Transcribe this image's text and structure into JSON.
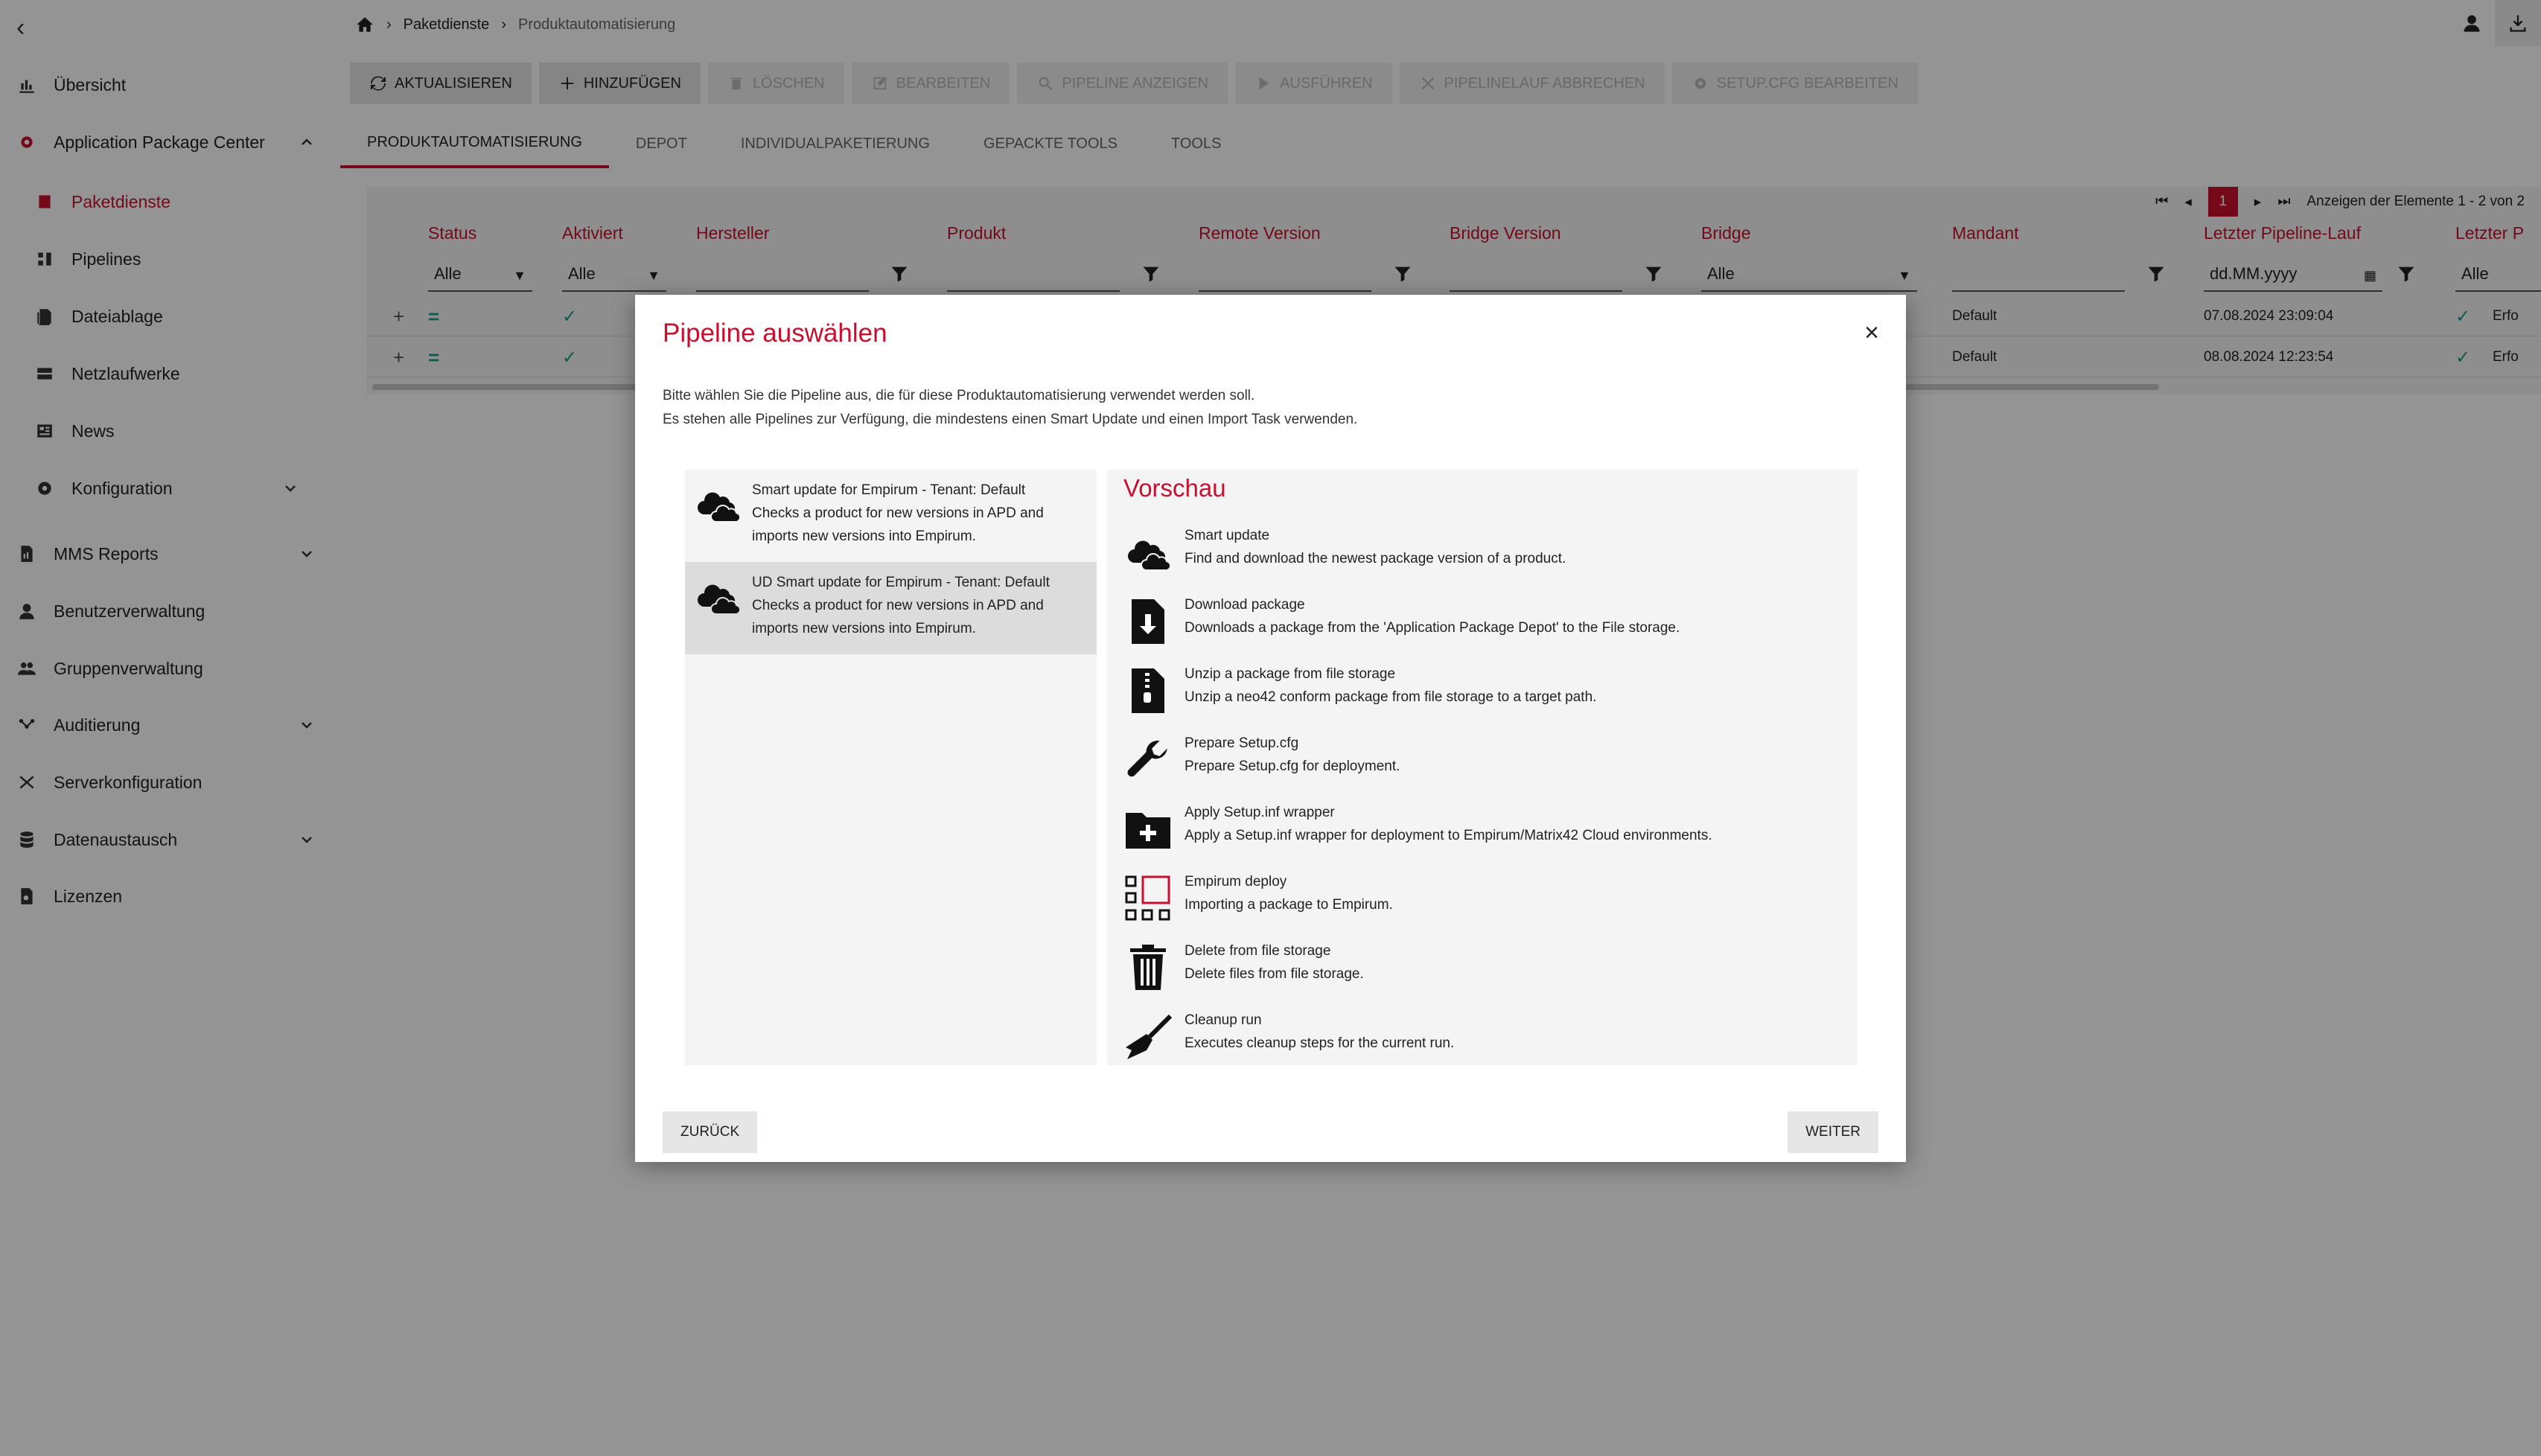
{
  "sidebar": {
    "items": [
      {
        "label": "Übersicht",
        "icon": "chart-icon"
      },
      {
        "label": "Application Package Center",
        "icon": "gear-icon"
      },
      {
        "label": "Paketdienste",
        "icon": "package-icon"
      },
      {
        "label": "Pipelines",
        "icon": "pipeline-icon"
      },
      {
        "label": "Dateiablage",
        "icon": "file-storage-icon"
      },
      {
        "label": "Netzlaufwerke",
        "icon": "network-drive-icon"
      },
      {
        "label": "News",
        "icon": "news-icon"
      },
      {
        "label": "Konfiguration",
        "icon": "cog-icon"
      },
      {
        "label": "MMS Reports",
        "icon": "report-icon"
      },
      {
        "label": "Benutzerverwaltung",
        "icon": "user-icon"
      },
      {
        "label": "Gruppenverwaltung",
        "icon": "group-icon"
      },
      {
        "label": "Auditierung",
        "icon": "audit-icon"
      },
      {
        "label": "Serverkonfiguration",
        "icon": "server-icon"
      },
      {
        "label": "Datenaustausch",
        "icon": "database-icon"
      },
      {
        "label": "Lizenzen",
        "icon": "license-icon"
      }
    ]
  },
  "breadcrumb": {
    "section": "Paketdienste",
    "current": "Produktautomatisierung"
  },
  "toolbar": {
    "refresh": "Aktualisieren",
    "add": "Hinzufügen",
    "delete": "Löschen",
    "edit": "Bearbeiten",
    "show_pipeline": "Pipeline anzeigen",
    "run": "Ausführen",
    "cancel_run": "Pipelinelauf abbrechen",
    "edit_setup": "Setup.cfg bearbeiten"
  },
  "tabs": [
    "Produktautomatisierung",
    "Depot",
    "Individualpaketierung",
    "Gepackte Tools",
    "Tools"
  ],
  "grid": {
    "pager": {
      "page": "1",
      "info": "Anzeigen der Elemente 1 - 2 von 2"
    },
    "columns": [
      "Status",
      "Aktiviert",
      "Hersteller",
      "Produkt",
      "Remote Version",
      "Bridge Version",
      "Bridge",
      "Mandant",
      "Letzter Pipeline-Lauf",
      "Letzter P"
    ],
    "filters": {
      "status": "Alle",
      "aktiviert": "Alle",
      "bridge": "Alle",
      "date_placeholder": "dd.MM.yyyy",
      "last": "Alle"
    },
    "rows": [
      {
        "mandant": "Default",
        "last_run": "07.08.2024 23:09:04",
        "result": "Erfo"
      },
      {
        "mandant": "Default",
        "last_run": "08.08.2024 12:23:54",
        "result": "Erfo"
      }
    ]
  },
  "dialog": {
    "title": "Pipeline auswählen",
    "desc_line1": "Bitte wählen Sie die Pipeline aus, die für diese Produktautomatisierung verwendet werden soll.",
    "desc_line2": "Es stehen alle Pipelines zur Verfügung, die mindestens einen Smart Update und einen Import Task verwenden.",
    "pipelines": [
      {
        "name": "Smart update for Empirum - Tenant: Default",
        "desc1": "Checks a product for new versions in APD and",
        "desc2": "imports new versions into Empirum."
      },
      {
        "name": "UD Smart update for Empirum - Tenant: Default",
        "desc1": "Checks a product for new versions in APD and",
        "desc2": "imports new versions into Empirum."
      }
    ],
    "preview_title": "Vorschau",
    "steps": [
      {
        "name": "Smart update",
        "desc": "Find and download the newest package version of a product."
      },
      {
        "name": "Download package",
        "desc": "Downloads a package from the 'Application Package Depot' to the File storage."
      },
      {
        "name": "Unzip a package from file storage",
        "desc": "Unzip a neo42 conform package from file storage to a target path."
      },
      {
        "name": "Prepare Setup.cfg",
        "desc": "Prepare Setup.cfg for deployment."
      },
      {
        "name": "Apply Setup.inf wrapper",
        "desc": "Apply a Setup.inf wrapper for deployment to Empirum/Matrix42 Cloud environments."
      },
      {
        "name": "Empirum deploy",
        "desc": "Importing a package to Empirum."
      },
      {
        "name": "Delete from file storage",
        "desc": "Delete files from file storage."
      },
      {
        "name": "Cleanup run",
        "desc": "Executes cleanup steps for the current run."
      }
    ],
    "back": "Zurück",
    "next": "Weiter"
  },
  "colors": {
    "accent": "#c8102e",
    "overlay": "rgba(0,0,0,0.42)"
  }
}
